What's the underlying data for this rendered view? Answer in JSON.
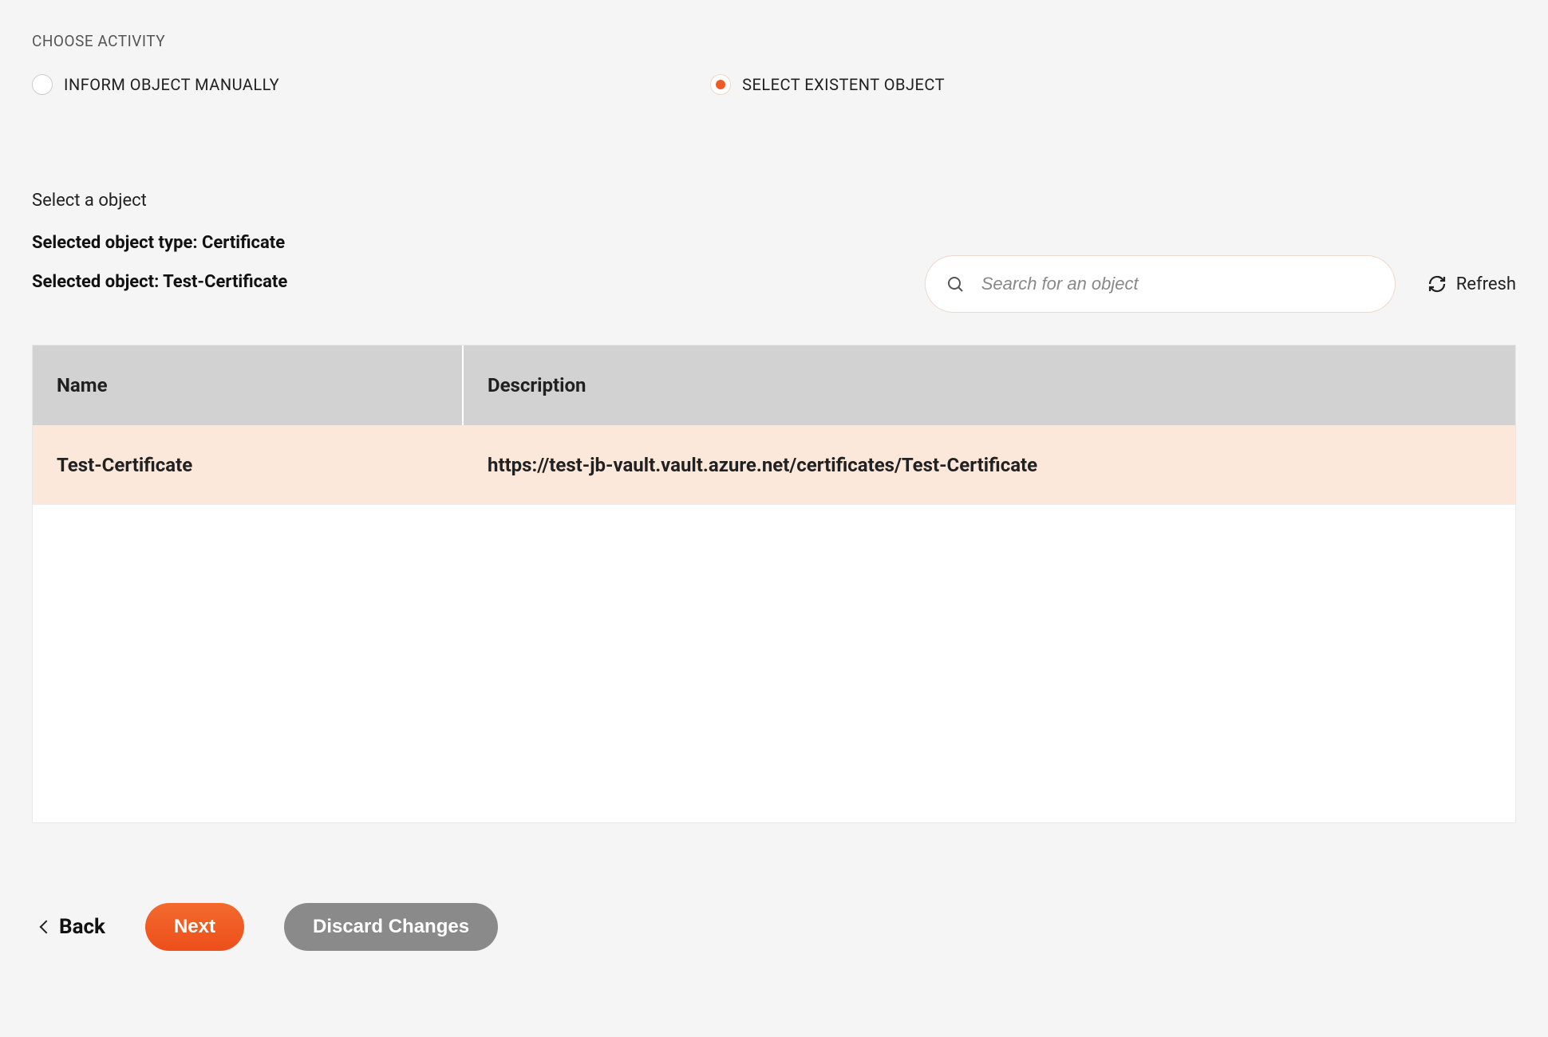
{
  "header": {
    "choose_activity": "CHOOSE ACTIVITY"
  },
  "activity": {
    "manual_label": "INFORM OBJECT MANUALLY",
    "select_label": "SELECT EXISTENT OBJECT",
    "selected": "select"
  },
  "select": {
    "prompt": "Select a object",
    "type_label": "Selected object type: Certificate",
    "object_label": "Selected object: Test-Certificate"
  },
  "search": {
    "placeholder": "Search for an object"
  },
  "refresh": {
    "label": "Refresh"
  },
  "table": {
    "columns": {
      "name": "Name",
      "description": "Description"
    },
    "rows": [
      {
        "name": "Test-Certificate",
        "description": "https://test-jb-vault.vault.azure.net/certificates/Test-Certificate",
        "selected": true
      }
    ]
  },
  "footer": {
    "back": "Back",
    "next": "Next",
    "discard": "Discard Changes"
  }
}
